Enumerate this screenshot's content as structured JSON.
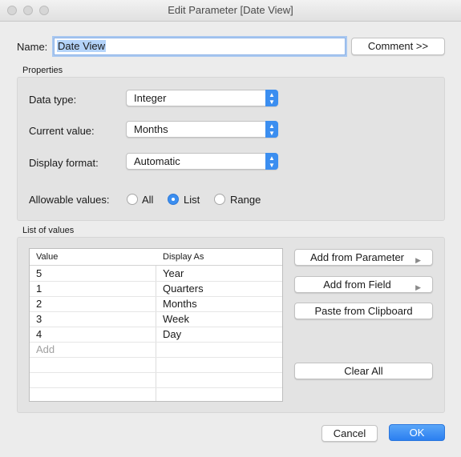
{
  "window": {
    "title": "Edit Parameter [Date View]"
  },
  "name_row": {
    "label": "Name:",
    "value": "Date View",
    "comment_button": "Comment >>"
  },
  "properties": {
    "section_label": "Properties",
    "data_type": {
      "label": "Data type:",
      "value": "Integer"
    },
    "current_value": {
      "label": "Current value:",
      "value": "Months"
    },
    "display_format": {
      "label": "Display format:",
      "value": "Automatic"
    },
    "allowable": {
      "label": "Allowable values:",
      "options": [
        "All",
        "List",
        "Range"
      ],
      "selected": "List"
    }
  },
  "list_of_values": {
    "section_label": "List of values",
    "columns": [
      "Value",
      "Display As"
    ],
    "rows": [
      {
        "value": "5",
        "display": "Year"
      },
      {
        "value": "1",
        "display": "Quarters"
      },
      {
        "value": "2",
        "display": "Months"
      },
      {
        "value": "3",
        "display": "Week"
      },
      {
        "value": "4",
        "display": "Day"
      }
    ],
    "add_placeholder": "Add",
    "buttons": {
      "add_from_parameter": "Add from Parameter",
      "add_from_field": "Add from Field",
      "paste_from_clipboard": "Paste from Clipboard",
      "clear_all": "Clear All"
    }
  },
  "footer": {
    "cancel": "Cancel",
    "ok": "OK"
  },
  "colors": {
    "accent": "#3b8ef0",
    "background": "#ececec",
    "group": "#e3e3e3"
  },
  "icons": {
    "dropdown": "updown-chevron-icon",
    "submenu": "right-triangle-icon"
  }
}
